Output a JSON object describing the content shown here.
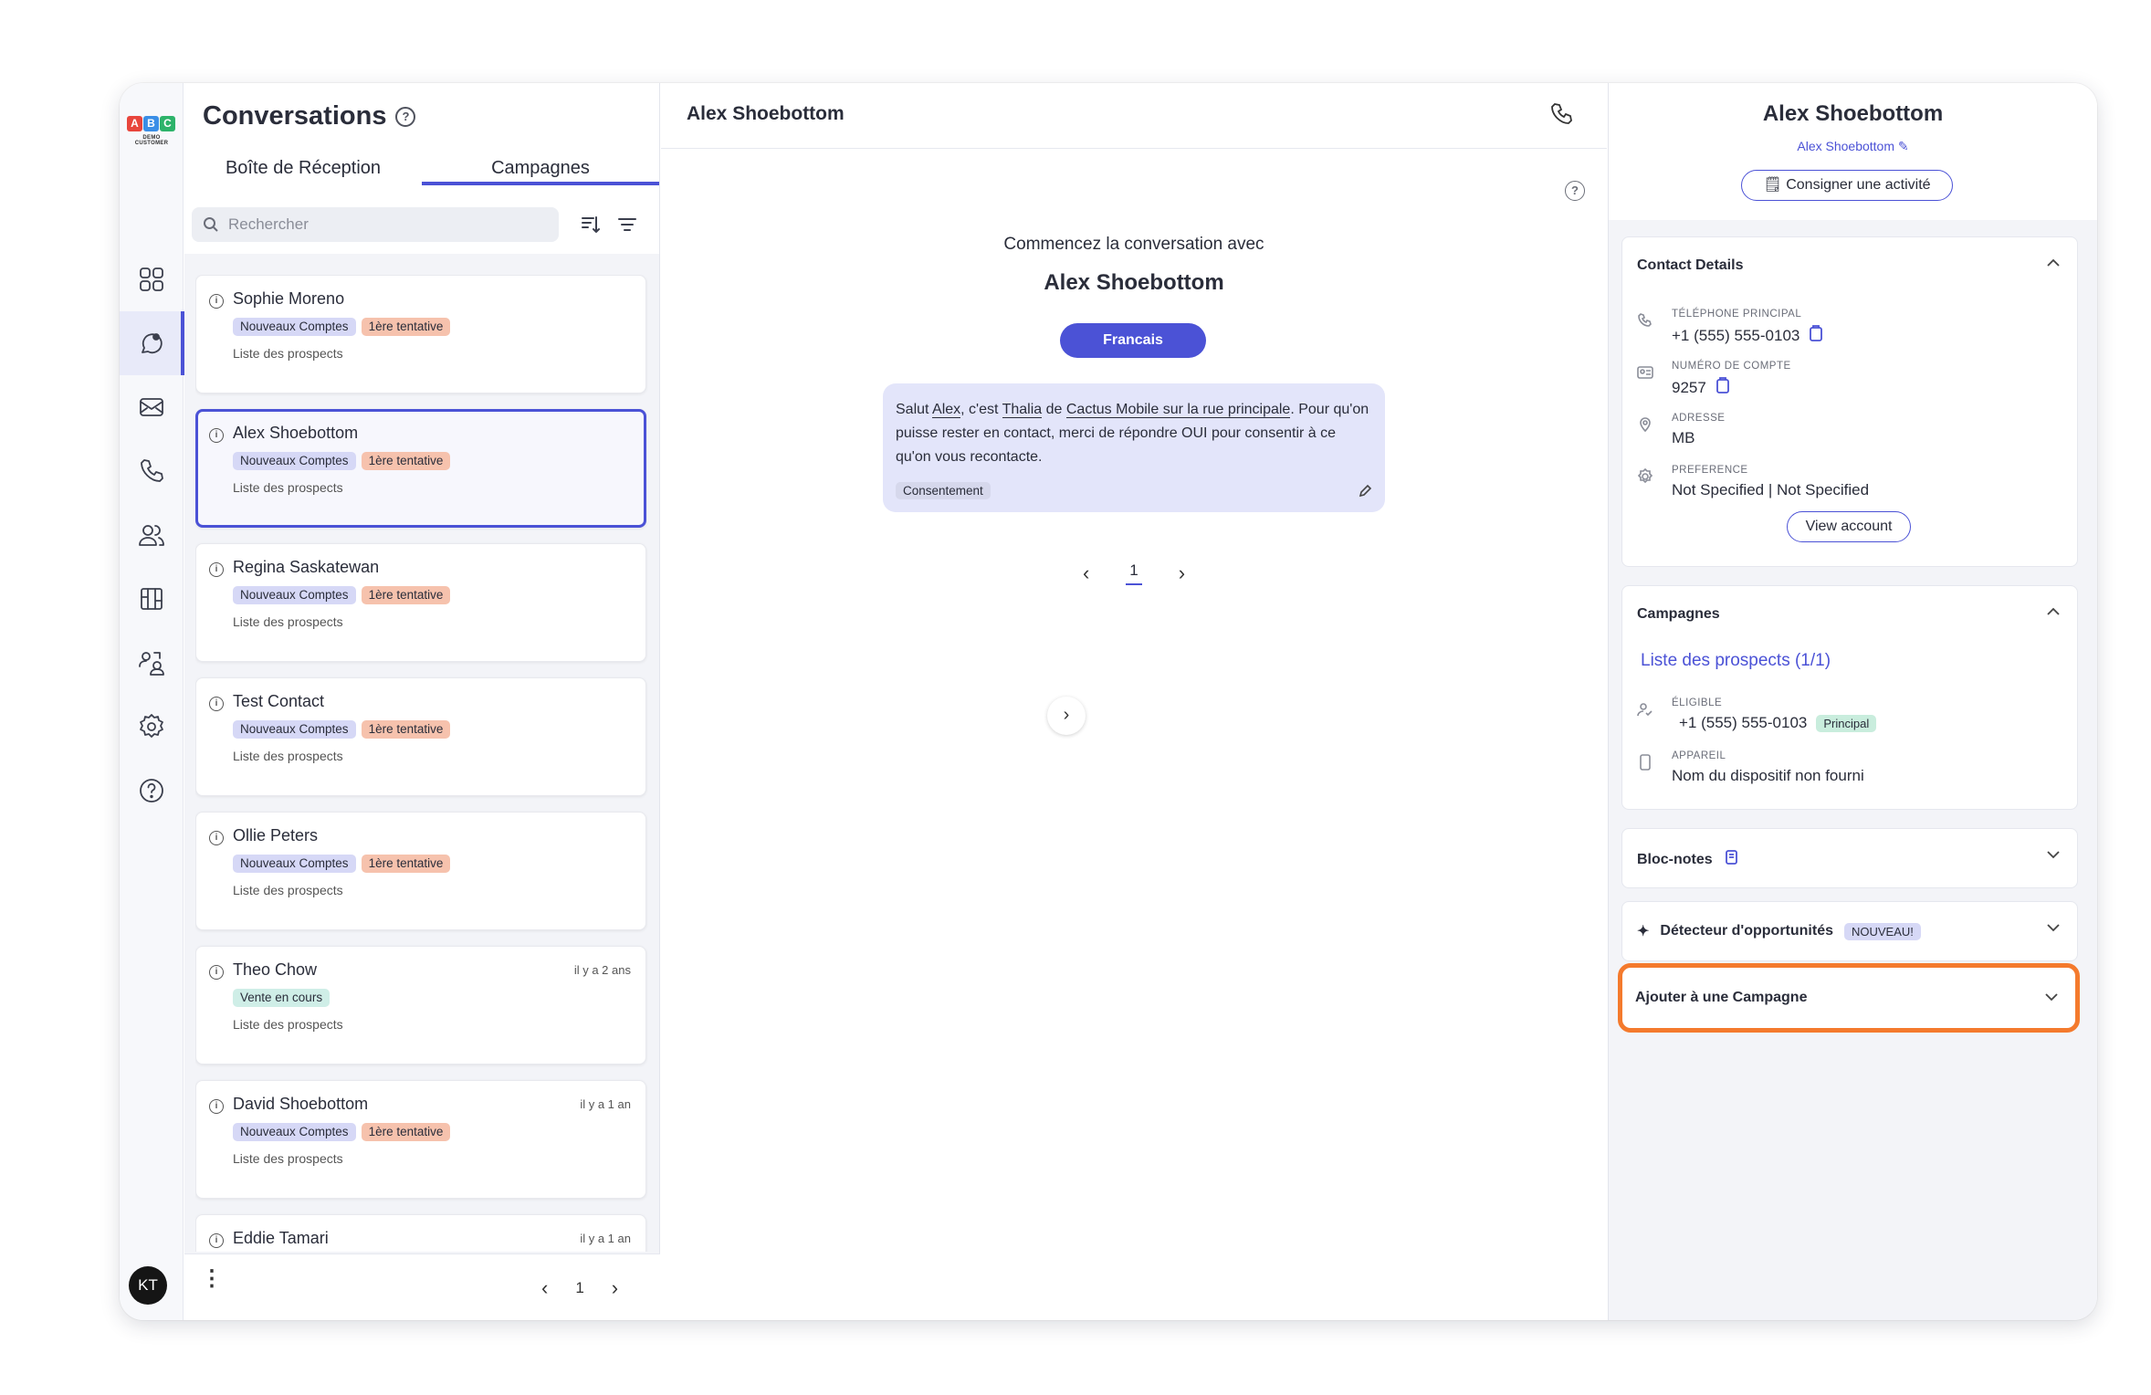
{
  "brand": {
    "logo_letters": [
      "A",
      "B",
      "C"
    ],
    "logo_sub": "DEMO CUSTOMER",
    "colors": {
      "accent": "#4b52d6",
      "highlight": "#f47a2d"
    }
  },
  "user": {
    "initials": "KT"
  },
  "nav": {
    "items": [
      {
        "icon": "dashboard-grid-icon"
      },
      {
        "icon": "chat-bubble-icon",
        "active": true
      },
      {
        "icon": "mail-inbox-icon"
      },
      {
        "icon": "phone-icon"
      },
      {
        "icon": "people-icon"
      },
      {
        "icon": "board-icon"
      },
      {
        "icon": "contacts-switch-icon"
      },
      {
        "icon": "gear-icon"
      },
      {
        "icon": "help-circle-icon"
      }
    ]
  },
  "list": {
    "title": "Conversations",
    "tabs": [
      "Boîte de Réception",
      "Campagnes"
    ],
    "active_tab": 1,
    "search_placeholder": "Rechercher",
    "items": [
      {
        "name": "Sophie Moreno",
        "time": "",
        "tags": [
          "Nouveaux Comptes",
          "1ère tentative"
        ],
        "sub": "Liste des prospects"
      },
      {
        "name": "Alex Shoebottom",
        "time": "",
        "tags": [
          "Nouveaux Comptes",
          "1ère tentative"
        ],
        "sub": "Liste des prospects",
        "selected": true
      },
      {
        "name": "Regina Saskatewan",
        "time": "",
        "tags": [
          "Nouveaux Comptes",
          "1ère tentative"
        ],
        "sub": "Liste des prospects"
      },
      {
        "name": "Test Contact",
        "time": "",
        "tags": [
          "Nouveaux Comptes",
          "1ère tentative"
        ],
        "sub": "Liste des prospects"
      },
      {
        "name": "Ollie Peters",
        "time": "",
        "tags": [
          "Nouveaux Comptes",
          "1ère tentative"
        ],
        "sub": "Liste des prospects"
      },
      {
        "name": "Theo Chow",
        "time": "il y a 2 ans",
        "tags": [
          "Vente en cours"
        ],
        "sub": "Liste des prospects"
      },
      {
        "name": "David Shoebottom",
        "time": "il y a 1 an",
        "tags": [
          "Nouveaux Comptes",
          "1ère tentative"
        ],
        "sub": "Liste des prospects"
      },
      {
        "name": "Eddie Tamari",
        "time": "il y a 1 an",
        "tags": [],
        "sub": ""
      }
    ],
    "page": "1"
  },
  "conversation": {
    "title": "Alex Shoebottom",
    "start_text": "Commencez la conversation avec",
    "start_name": "Alex Shoebottom",
    "language": "Francais",
    "message": {
      "p1": "Salut ",
      "name": "Alex",
      "p2": ", c'est ",
      "agent": "Thalia",
      "p3": " de ",
      "store": "Cactus Mobile sur la rue principale",
      "p4": ". Pour qu'on puisse rester en contact, merci de répondre OUI pour consentir à ce qu'on vous recontacte.",
      "tag": "Consentement"
    },
    "page": "1"
  },
  "contact": {
    "name": "Alex Shoebottom",
    "sub": "Alex Shoebottom",
    "log_button": "Consigner une activité",
    "details": {
      "title": "Contact Details",
      "phone_label": "TÉLÉPHONE PRINCIPAL",
      "phone": "+1 (555) 555-0103",
      "account_label": "NUMÉRO DE COMPTE",
      "account": "9257",
      "address_label": "ADRESSE",
      "address": "MB",
      "preference_label": "PREFERENCE",
      "preference": "Not Specified | Not Specified",
      "view_button": "View account"
    },
    "campaigns": {
      "title": "Campagnes",
      "link": "Liste des prospects (1/1)",
      "eligible_label": "ÉLIGIBLE",
      "eligible_phone": "+1 (555) 555-0103",
      "eligible_badge": "Principal",
      "device_label": "APPAREIL",
      "device": "Nom du dispositif non fourni"
    },
    "notes": {
      "title": "Bloc-notes"
    },
    "opportunities": {
      "title": "Détecteur d'opportunités",
      "badge": "NOUVEAU!"
    },
    "add_campaign": {
      "title": "Ajouter à une Campagne"
    }
  }
}
